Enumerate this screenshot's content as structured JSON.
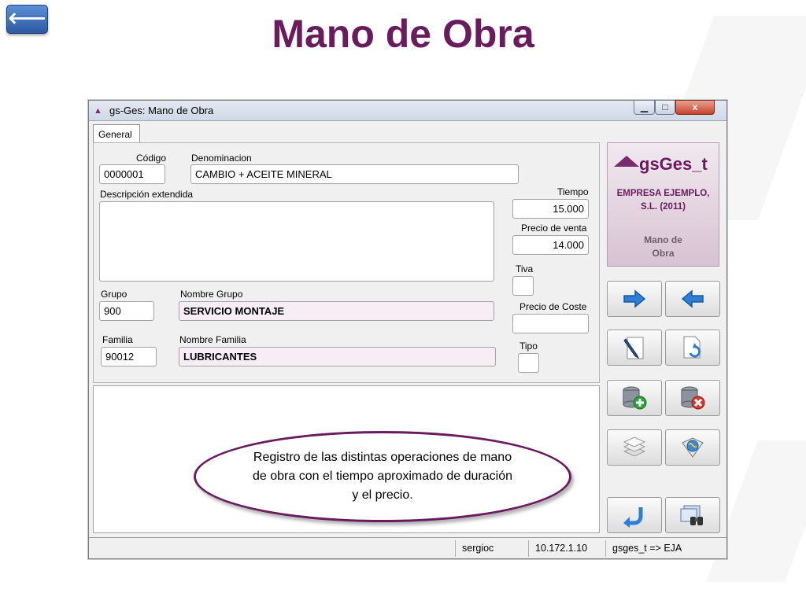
{
  "slide": {
    "title": "Mano de Obra",
    "back_icon": "arrow-left-icon"
  },
  "window": {
    "title": "gs-Ges: Mano de Obra",
    "controls": {
      "minimize": "▁",
      "maximize": "□",
      "close": "x"
    }
  },
  "tabs": [
    {
      "label": "General",
      "active": true
    }
  ],
  "form": {
    "codigo": {
      "label": "Código",
      "value": "0000001"
    },
    "denominacion": {
      "label": "Denominacion",
      "value": "CAMBIO + ACEITE MINERAL"
    },
    "descripcion": {
      "label": "Descripción extendida",
      "value": ""
    },
    "tiempo": {
      "label": "Tiempo",
      "value": "15.000"
    },
    "precio_venta": {
      "label": "Precio de venta",
      "value": "14.000"
    },
    "tiva": {
      "label": "Tiva",
      "value": ""
    },
    "grupo": {
      "label": "Grupo",
      "value": "900"
    },
    "nombre_grupo": {
      "label": "Nombre Grupo",
      "value": "SERVICIO MONTAJE"
    },
    "precio_coste": {
      "label": "Precio de Coste",
      "value": ""
    },
    "familia": {
      "label": "Familia",
      "value": "90012"
    },
    "nombre_familia": {
      "label": "Nombre Familia",
      "value": "LUBRICANTES"
    },
    "tipo": {
      "label": "Tipo",
      "value": ""
    }
  },
  "logo": {
    "brand": "gsGes_t",
    "company_line1": "EMPRESA EJEMPLO,",
    "company_line2": "S.L. (2011)",
    "module_line1": "Mano de",
    "module_line2": "Obra"
  },
  "actions": [
    {
      "name": "next-button",
      "icon": "arrow-right-icon"
    },
    {
      "name": "previous-button",
      "icon": "arrow-left-icon"
    },
    {
      "name": "edit-button",
      "icon": "pen-document-icon"
    },
    {
      "name": "undo-document-button",
      "icon": "document-undo-icon"
    },
    {
      "name": "add-record-button",
      "icon": "database-add-icon"
    },
    {
      "name": "delete-record-button",
      "icon": "database-delete-icon"
    },
    {
      "name": "pages-button",
      "icon": "stacked-pages-icon"
    },
    {
      "name": "globe-button",
      "icon": "globe-icon"
    },
    {
      "name": "return-button",
      "icon": "return-arrow-icon"
    },
    {
      "name": "search-button",
      "icon": "binoculars-icon"
    }
  ],
  "callout": "Registro de las distintas operaciones de mano de obra con el tiempo aproximado de duración y el precio.",
  "status": {
    "user": "sergioc",
    "ip": "10.172.1.10",
    "db": "gsges_t => EJA"
  },
  "colors": {
    "brand_purple": "#6a1b5e",
    "title_bar": "#dde4ee",
    "pink_field": "#f7eef5",
    "accent_blue": "#2c7fd8"
  }
}
